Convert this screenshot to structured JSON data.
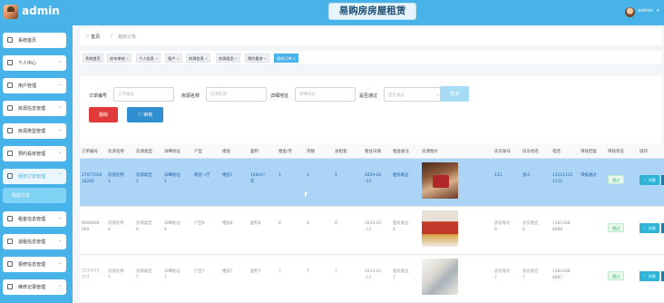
{
  "app": {
    "name": "admin",
    "banner": "易购房房屋租赁",
    "user": {
      "name": "admin",
      "caret": "▾"
    }
  },
  "sidebar": {
    "items": [
      {
        "label": "系统首页",
        "icon": "home-icon",
        "caret": ""
      },
      {
        "label": "个人中心",
        "icon": "person-icon",
        "caret": "⌄"
      },
      {
        "label": "用户管理",
        "icon": "users-icon",
        "caret": "⌄"
      },
      {
        "label": "房源信息管理",
        "icon": "house-icon",
        "caret": "⌄"
      },
      {
        "label": "房源类型管理",
        "icon": "house-type-icon",
        "caret": "⌄"
      },
      {
        "label": "预约看房管理",
        "icon": "calendar-icon",
        "caret": "⌄"
      },
      {
        "label": "租房订单管理",
        "icon": "order-icon",
        "caret": "⌃"
      },
      {
        "label": "租金信息管理",
        "icon": "money-icon",
        "caret": "⌄"
      },
      {
        "label": "退租信息管理",
        "icon": "return-icon",
        "caret": "⌄"
      },
      {
        "label": "报修信息管理",
        "icon": "repair-icon",
        "caret": "⌄"
      },
      {
        "label": "维修记录管理",
        "icon": "record-icon",
        "caret": "⌄"
      }
    ],
    "active_sub": "租房订单"
  },
  "breadcrumb": {
    "home": "首页",
    "separator": "/",
    "current": "租房订单"
  },
  "tags": [
    {
      "label": "系统首页",
      "close": ""
    },
    {
      "label": "房东审核",
      "close": "×"
    },
    {
      "label": "个人信息",
      "close": "×"
    },
    {
      "label": "租户",
      "close": "×"
    },
    {
      "label": "房源信息",
      "close": "×"
    },
    {
      "label": "房源类型",
      "close": "×"
    },
    {
      "label": "预约看房",
      "close": "×"
    },
    {
      "label": "租房订单",
      "close": "×"
    }
  ],
  "search": {
    "fields": [
      {
        "label": "订单编号",
        "placeholder": "订单编号"
      },
      {
        "label": "房源名称",
        "placeholder": "房源名称"
      },
      {
        "label": "详细地址",
        "placeholder": "详细地址"
      }
    ],
    "approve_label": "是否通过",
    "approve_placeholder": "是否通过",
    "search_button": "查询",
    "delete_button": "删除",
    "review_button": "♡ 审核"
  },
  "table": {
    "headers": [
      "订单编号",
      "房源名称",
      "房源类型",
      "详细地址",
      "户型",
      "楼层",
      "面积",
      "租金/月",
      "月数",
      "总租金",
      "租住日期",
      "租金备注",
      "房源图片",
      "房东账号",
      "房东姓名",
      "电话",
      "审核回复",
      "审核状态",
      "操作"
    ],
    "rows": [
      {
        "selected": true,
        "cells": [
          "17077016\n16292",
          "房源名称\n1",
          "房源类型\n1",
          "详细地址\n1",
          "两室一厅",
          "楼层1",
          "100m²/\n年",
          "1",
          "1",
          "1",
          "2024-02\n-13",
          "租房备注\n",
          "",
          "111",
          "张三",
          "13111111\n1111",
          "审核通过"
        ],
        "status": "通过",
        "action": "♡ 详情"
      },
      {
        "selected": false,
        "cells": [
          "8888888\n888",
          "房源名称\n8",
          "房源类型\n8",
          "详细地址\n8",
          "户型8",
          "楼层8",
          "面积8",
          "8",
          "8",
          "8",
          "2024-02\n-13",
          "租房备注\n8",
          "",
          "房东账号\n8",
          "房东姓名\n8",
          "1382388\n8888",
          ""
        ],
        "status": "通过",
        "action": "♡ 详情"
      },
      {
        "selected": false,
        "cells": [
          "7777777\n777",
          "房源名称\n7",
          "房源类型\n7",
          "详细地址\n7",
          "户型7",
          "楼层7",
          "面积7",
          "7",
          "7",
          "7",
          "2024-02\n-13",
          "租房备注\n7",
          "",
          "房东账号\n7",
          "房东姓名\n7",
          "1382388\n8887",
          ""
        ],
        "status": "通过",
        "action": "♡ 详情"
      }
    ]
  },
  "colors": {
    "accent": "#47b3e8",
    "delete": "#e03a3a",
    "review": "#2f8fd0",
    "selected_row": "#abd4f6",
    "status_ok": "#3bb36b"
  }
}
